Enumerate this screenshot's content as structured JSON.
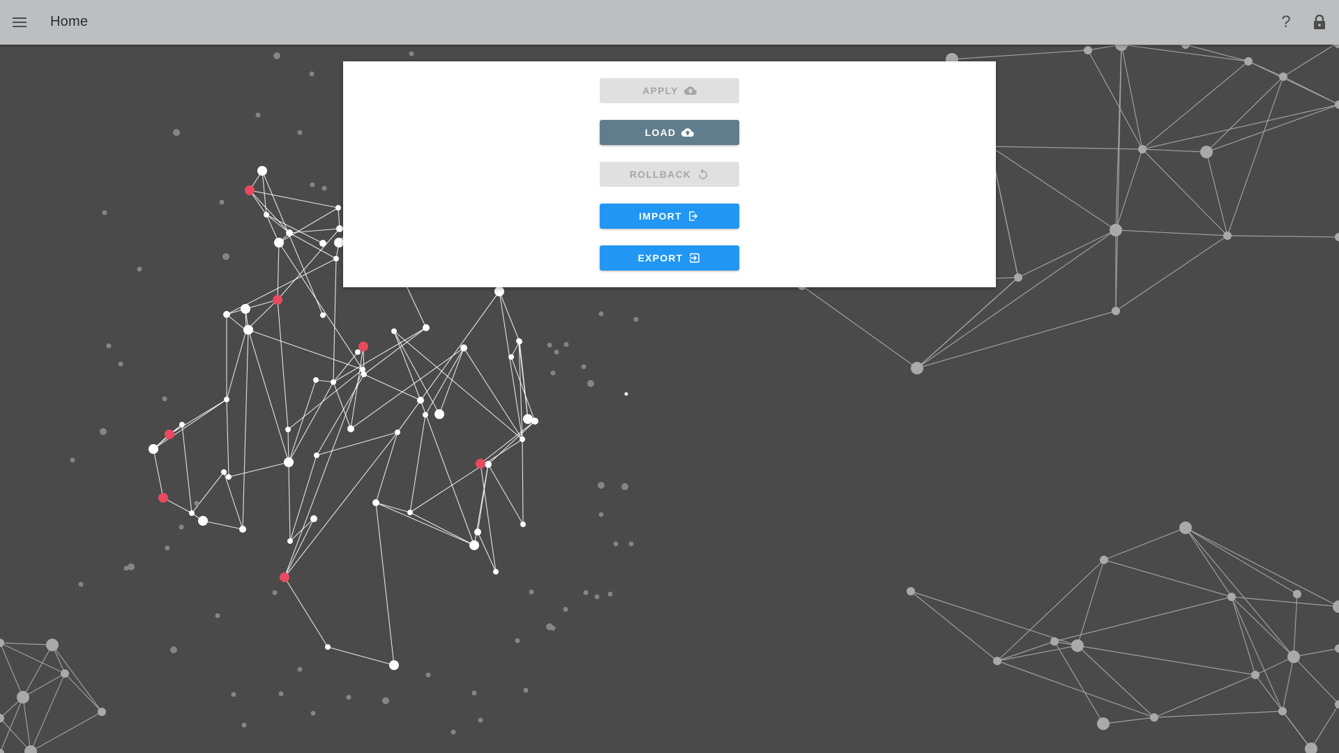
{
  "header": {
    "title": "Home",
    "menu_icon": "hamburger-menu-icon",
    "help_label": "?",
    "lock_icon": "lock-icon",
    "background": "#bdbec0"
  },
  "actions": {
    "apply": {
      "label": "APPLY",
      "icon": "cloud-upload-icon",
      "state": "disabled"
    },
    "load": {
      "label": "LOAD",
      "icon": "cloud-upload-icon",
      "state": "enabled"
    },
    "rollback": {
      "label": "ROLLBACK",
      "icon": "rotate-ccw-icon",
      "state": "disabled"
    },
    "import": {
      "label": "IMPORT",
      "icon": "sign-in-icon",
      "state": "enabled"
    },
    "export": {
      "label": "EXPORT",
      "icon": "sign-out-icon",
      "state": "enabled"
    }
  },
  "colors": {
    "page_background": "#4a4a4a",
    "card_background": "#ffffff",
    "load_button": "#607d8b",
    "primary_button": "#2196f3",
    "disabled_button": "#e0e0e0",
    "accent_node": "#e84a5f",
    "network_white": "#ffffff",
    "network_grey": "#a9a9a9"
  }
}
